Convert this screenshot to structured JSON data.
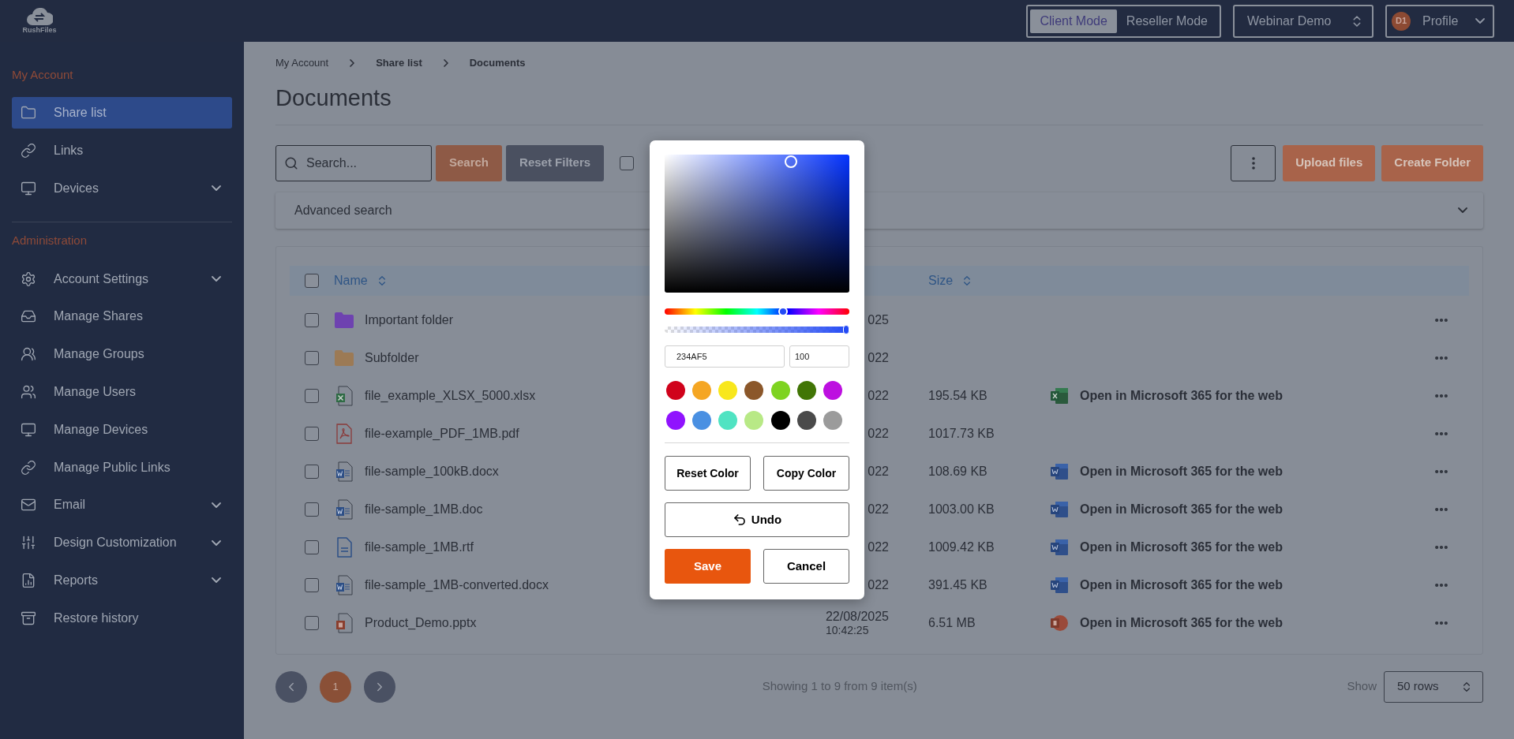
{
  "top_bar": {
    "logo_text": "RushFiles",
    "modes": [
      {
        "label": "Client Mode",
        "selected": true
      },
      {
        "label": "Reseller Mode",
        "selected": false
      }
    ],
    "workspace": "Webinar Demo",
    "profile": {
      "initials": "D1",
      "label": "Profile"
    }
  },
  "sidebar": {
    "sections": [
      {
        "title": "My Account",
        "items": [
          {
            "label": "Share list",
            "selected": true,
            "expandable": false
          },
          {
            "label": "Links",
            "selected": false,
            "expandable": false
          },
          {
            "label": "Devices",
            "selected": false,
            "expandable": true
          }
        ]
      },
      {
        "title": "Administration",
        "items": [
          {
            "label": "Account Settings",
            "selected": false,
            "expandable": true
          },
          {
            "label": "Manage Shares",
            "selected": false,
            "expandable": false
          },
          {
            "label": "Manage Groups",
            "selected": false,
            "expandable": false
          },
          {
            "label": "Manage Users",
            "selected": false,
            "expandable": false
          },
          {
            "label": "Manage Devices",
            "selected": false,
            "expandable": false
          },
          {
            "label": "Manage Public Links",
            "selected": false,
            "expandable": false
          },
          {
            "label": "Email",
            "selected": false,
            "expandable": true
          },
          {
            "label": "Design Customization",
            "selected": false,
            "expandable": true
          },
          {
            "label": "Reports",
            "selected": false,
            "expandable": true
          },
          {
            "label": "Restore history",
            "selected": false,
            "expandable": false
          }
        ]
      }
    ]
  },
  "breadcrumb": [
    "My Account",
    "Share list",
    "Documents"
  ],
  "page_title": "Documents",
  "toolbar": {
    "search_placeholder": "Search...",
    "search_button": "Search",
    "reset_button": "Reset Filters",
    "filter_checked": false,
    "upload_button": "Upload files",
    "create_button": "Create Folder"
  },
  "advanced_search": {
    "label": "Advanced search",
    "expanded": false
  },
  "table": {
    "columns": {
      "name": "Name",
      "size": "Size"
    },
    "header_checked": false,
    "rows": [
      {
        "kind": "folder",
        "color": "#6e42b0",
        "name": "Important folder",
        "date": "025",
        "checked": false
      },
      {
        "kind": "folder",
        "color": "#9c7a55",
        "name": "Subfolder",
        "date": "022",
        "checked": false
      },
      {
        "kind": "xlsx",
        "name": "file_example_XLSX_5000.xlsx",
        "date": "022",
        "size": "195.54 KB",
        "open": "Open in Microsoft 365 for the web",
        "checked": false
      },
      {
        "kind": "pdf",
        "name": "file-example_PDF_1MB.pdf",
        "date": "022",
        "size": "1017.73 KB",
        "checked": false
      },
      {
        "kind": "docx",
        "name": "file-sample_100kB.docx",
        "date": "022",
        "size": "108.69 KB",
        "open": "Open in Microsoft 365 for the web",
        "checked": false
      },
      {
        "kind": "docx",
        "name": "file-sample_1MB.doc",
        "date": "022",
        "size": "1003.00 KB",
        "open": "Open in Microsoft 365 for the web",
        "checked": false
      },
      {
        "kind": "rtf",
        "name": "file-sample_1MB.rtf",
        "date": "022",
        "size": "1009.42 KB",
        "open": "Open in Microsoft 365 for the web",
        "checked": false
      },
      {
        "kind": "docx",
        "name": "file-sample_1MB-converted.docx",
        "date": "022",
        "size": "391.45 KB",
        "open": "Open in Microsoft 365 for the web",
        "checked": false
      },
      {
        "kind": "pptx",
        "name": "Product_Demo.pptx",
        "date": "22/08/2025",
        "time": "10:42:25",
        "size": "6.51 MB",
        "open": "Open in Microsoft 365 for the web",
        "checked": false
      }
    ]
  },
  "pagination": {
    "pages": [
      {
        "label": "1",
        "selected": true
      }
    ],
    "summary": "Showing 1 to 9 from 9 item(s)",
    "show_label": "Show",
    "rows_select": "50 rows"
  },
  "color_picker": {
    "hue": {
      "level": 0.64
    },
    "alpha": {
      "level": 1
    },
    "hex": "234AF5",
    "alpha_value": "100",
    "swatches": [
      {
        "color": "#d0021b"
      },
      {
        "color": "#f5a623"
      },
      {
        "color": "#f8e71c"
      },
      {
        "color": "#8b572a"
      },
      {
        "color": "#7ed321"
      },
      {
        "color": "#417505"
      },
      {
        "color": "#bd10e0"
      },
      {
        "color": "#9013fe"
      },
      {
        "color": "#4a90e2"
      },
      {
        "color": "#50e3c2"
      },
      {
        "color": "#b8e986"
      },
      {
        "color": "#000000"
      },
      {
        "color": "#4a4a4a"
      },
      {
        "color": "#9b9b9b"
      }
    ],
    "reset_button": "Reset Color",
    "copy_button": "Copy Color",
    "undo_button": "Undo",
    "save_button": "Save",
    "cancel_button": "Cancel"
  }
}
